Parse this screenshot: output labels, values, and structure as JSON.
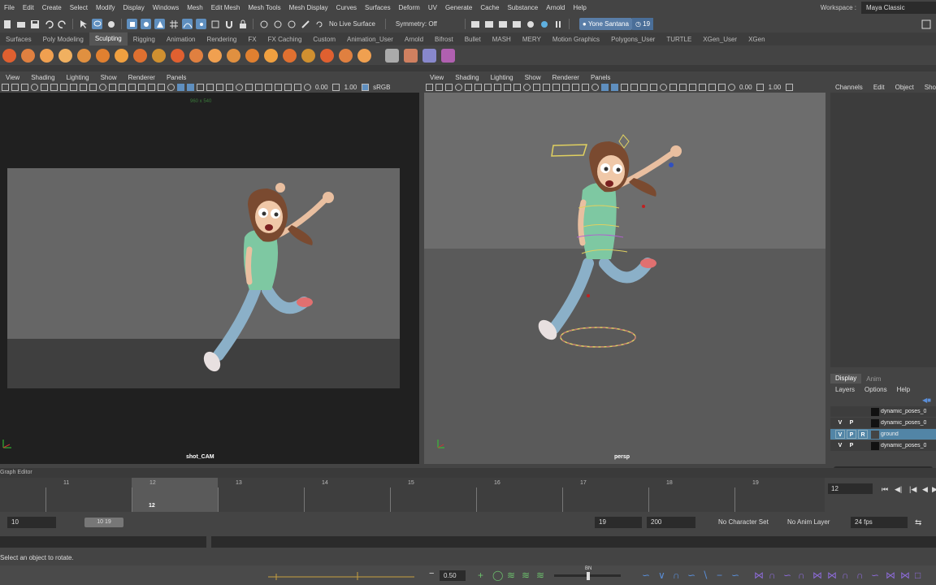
{
  "menubar": {
    "items": [
      "File",
      "Edit",
      "Create",
      "Select",
      "Modify",
      "Display",
      "Windows",
      "Mesh",
      "Edit Mesh",
      "Mesh Tools",
      "Mesh Display",
      "Curves",
      "Surfaces",
      "Deform",
      "UV",
      "Generate",
      "Cache",
      "Substance",
      "Arnold",
      "Help"
    ],
    "workspace_label": "Workspace :",
    "workspace_value": "Maya Classic"
  },
  "statusline": {
    "live_surface": "No Live Surface",
    "symmetry": "Symmetry: Off",
    "user_name": "Yone Santana",
    "notification_count": "19"
  },
  "shelf": {
    "tabs": [
      "Surfaces",
      "Poly Modeling",
      "Sculpting",
      "Rigging",
      "Animation",
      "Rendering",
      "FX",
      "FX Caching",
      "Custom",
      "Animation_User",
      "Arnold",
      "Bifrost",
      "Bullet",
      "MASH",
      "MERY",
      "Motion Graphics",
      "Polygons_User",
      "TURTLE",
      "XGen_User",
      "XGen"
    ],
    "active_tab": "Sculpting",
    "icon_colors": [
      "#e06030",
      "#e08040",
      "#f0a050",
      "#f0b060",
      "#e09040",
      "#e08030",
      "#f0a040",
      "#e07030",
      "#d09030",
      "#e06030",
      "#e08040",
      "#f0a050",
      "#e09040",
      "#e08030",
      "#f0a040",
      "#e07030",
      "#d09030",
      "#e06030",
      "#e08040",
      "#f0a050",
      "#aaaaaa",
      "#d08060",
      "#8888cc",
      "#b060b0"
    ]
  },
  "left_panel": {
    "menu": [
      "View",
      "Shading",
      "Lighting",
      "Show",
      "Renderer",
      "Panels"
    ],
    "field_a": "0.00",
    "field_b": "1.00",
    "colorspace": "sRGB",
    "resolution": "960 x 540",
    "camera_label": "shot_CAM"
  },
  "right_panel": {
    "menu": [
      "View",
      "Shading",
      "Lighting",
      "Show",
      "Renderer",
      "Panels"
    ],
    "field_a": "0.00",
    "field_b": "1.00",
    "camera_label": "persp"
  },
  "channel_box": {
    "menu": [
      "Channels",
      "Edit",
      "Object",
      "Show"
    ]
  },
  "layer_editor": {
    "tabs": [
      "Display",
      "Anim"
    ],
    "active_tab": "Display",
    "menu": [
      "Layers",
      "Options",
      "Help"
    ],
    "layers": [
      {
        "v": "",
        "p": "",
        "r": "",
        "name": "dynamic_poses_0",
        "selected": false
      },
      {
        "v": "V",
        "p": "P",
        "r": "",
        "name": "dynamic_poses_0",
        "selected": false
      },
      {
        "v": "V",
        "p": "P",
        "r": "R",
        "name": "ground",
        "selected": true
      },
      {
        "v": "V",
        "p": "P",
        "r": "",
        "name": "dynamic_poses_0",
        "selected": false
      }
    ]
  },
  "graph_editor": {
    "label": "Graph Editor"
  },
  "timeline": {
    "ticks": [
      "11",
      "12",
      "13",
      "14",
      "15",
      "16",
      "17",
      "18",
      "19"
    ],
    "current_frame": "12",
    "current_frame_field": "12"
  },
  "range": {
    "start": "10",
    "slider_start": "10",
    "slider_end": "19",
    "range_end": "19",
    "anim_end": "200",
    "character_set": "No Character Set",
    "anim_layer": "No Anim Layer",
    "fps": "24 fps"
  },
  "helpline": {
    "text": "Select an object to rotate."
  },
  "bottombar": {
    "value": "0.50",
    "slider_label": "BN"
  }
}
